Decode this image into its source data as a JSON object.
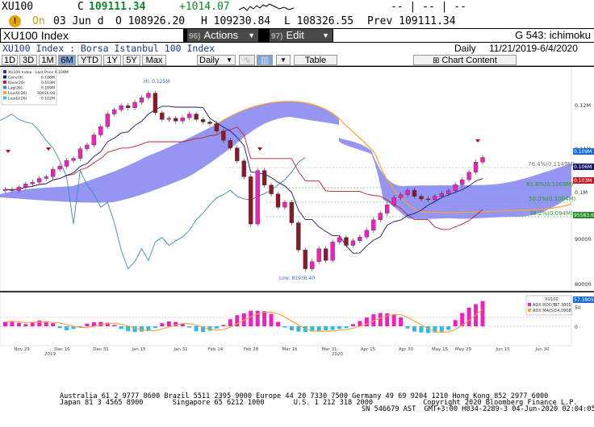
{
  "quote": {
    "ticker": "XU100",
    "close_label": "C",
    "last": "109111.34",
    "change": "+1014.07",
    "arrows": "-- | -- | --"
  },
  "row2": {
    "on": "On",
    "date": "03 Jun d",
    "open": "O 108926.20",
    "high": "H 109230.84",
    "low": "L 108326.55",
    "prev": "Prev 109111.34"
  },
  "menu": {
    "title": "XU100 Index",
    "actions_num": "96)",
    "actions": "Actions",
    "edit_num": "97)",
    "edit": "Edit",
    "function": "G 543: ichimoku"
  },
  "subtitle": {
    "desc": "XU100 Index : Borsa Istanbul 100 Index",
    "period": "Daily",
    "range": "11/21/2019-6/4/2020"
  },
  "toolbar": {
    "periods": [
      "1D",
      "3D",
      "1M",
      "6M",
      "YTD",
      "1Y",
      "5Y",
      "Max"
    ],
    "active_period": "6M",
    "chart_type": "Daily",
    "table": "Table",
    "content": "Chart Content"
  },
  "legend_main": [
    {
      "label": "XU100 Index - Last Price 0.109M",
      "color": "#1a3a8a"
    },
    {
      "label": "Conv(9)",
      "value": "0.106M",
      "color": "#1a1a6a"
    },
    {
      "label": "Base(26)",
      "value": "0.103M",
      "color": "#c0202a"
    },
    {
      "label": "Lag(26)",
      "value": "0.109M",
      "color": "#3a8ab8"
    },
    {
      "label": "Lead1(26)",
      "value": "93916.08",
      "color": "#ffa030"
    },
    {
      "label": "Lead2(26)",
      "value": "0.102M",
      "color": "#3ac0e0"
    }
  ],
  "annotations": {
    "high": "Hi: 0.125M",
    "low": "Low: 81936.40",
    "fib_76": "76.4%(0.1149M)",
    "fib_61": "61.8%(0.1069M)",
    "fib_50": "50.0%(0.1004M)",
    "fib_38": "38.2%(0.094M)"
  },
  "y_axis": {
    "ticks": [
      "0.12M",
      "0.11M",
      "0.1M",
      "90000",
      "80000"
    ],
    "price_tags": [
      {
        "label": "0.109M",
        "color": "#1a6ad0"
      },
      {
        "label": "0.106M",
        "color": "#1a1a6a"
      },
      {
        "label": "0.103M",
        "color": "#c0202a"
      },
      {
        "label": "95583.62",
        "color": "#2a8a2a"
      }
    ]
  },
  "adx": {
    "legend_title": "XU100",
    "items": [
      {
        "label": "ADX ROC(5)",
        "value": "57.3805",
        "color": "#f020c0"
      },
      {
        "label": "ADX MA(5)",
        "value": "54.0908",
        "color": "#ffa030"
      }
    ],
    "tag": "57.3805",
    "ticks": [
      "50",
      "0"
    ]
  },
  "x_axis": {
    "labels": [
      "Nov 29",
      "Dec 16",
      "Dec 31",
      "Jan 15",
      "Jan 31",
      "Feb 14",
      "Feb 28",
      "Mar 16",
      "Mar 31",
      "Apr 15",
      "Apr 30",
      "May 15",
      "May 29",
      "Jun 15",
      "Jun 30"
    ],
    "years": [
      "2019",
      "2020"
    ]
  },
  "footer": {
    "line1": "Australia 61 2 9777 8600 Brazil 5511 2395 9000 Europe 44 20 7330 7500 Germany 49 69 9204 1210 Hong Kong 852 2977 6000",
    "line2": "Japan 81 3 4565 8900       Singapore 65 6212 1000       U.S. 1 212 318 2000            Copyright 2020 Bloomberg Finance L.P.",
    "line3": "SN 546679 AST  GMT+3:00 H834-2289-3 04-Jun-2020 02:04:05"
  },
  "chart_data": {
    "type": "ichimoku-candlestick",
    "y_range": [
      78000,
      130000
    ],
    "closes": [
      101500,
      101200,
      102000,
      102800,
      103200,
      104100,
      104500,
      106300,
      107000,
      108400,
      108900,
      111200,
      112100,
      114500,
      116500,
      119500,
      120500,
      121500,
      121000,
      122300,
      123400,
      124500,
      119800,
      118200,
      118500,
      117800,
      118600,
      119500,
      118200,
      117600,
      117200,
      115400,
      113200,
      111400,
      108300,
      104500,
      93200,
      106000,
      102500,
      100400,
      97200,
      98400,
      93500,
      87000,
      82500,
      84200,
      87300,
      84500,
      88900,
      90000,
      88100,
      89200,
      90100,
      91700,
      94200,
      95800,
      97800,
      99500,
      100200,
      101300,
      99800,
      99200,
      99000,
      99800,
      100500,
      101200,
      102600,
      103800,
      105600,
      108000,
      109111
    ],
    "adx_roc": [
      10,
      12,
      8,
      5,
      9,
      13,
      11,
      7,
      -4,
      -9,
      -6,
      -2,
      6,
      9,
      10,
      8,
      3,
      -6,
      -11,
      -13,
      -12,
      -9,
      -4,
      7,
      11,
      10,
      6,
      -3,
      -11,
      -13,
      -10,
      -5,
      3,
      16,
      25,
      29,
      35,
      35,
      34,
      28,
      10,
      -3,
      -9,
      -12,
      -13,
      -12,
      -10,
      -9,
      -8,
      -6,
      -4,
      5,
      12,
      20,
      27,
      30,
      29,
      26,
      20,
      -5,
      -12,
      -14,
      -15,
      -14,
      -12,
      -8,
      14,
      30,
      42,
      50,
      57
    ]
  }
}
